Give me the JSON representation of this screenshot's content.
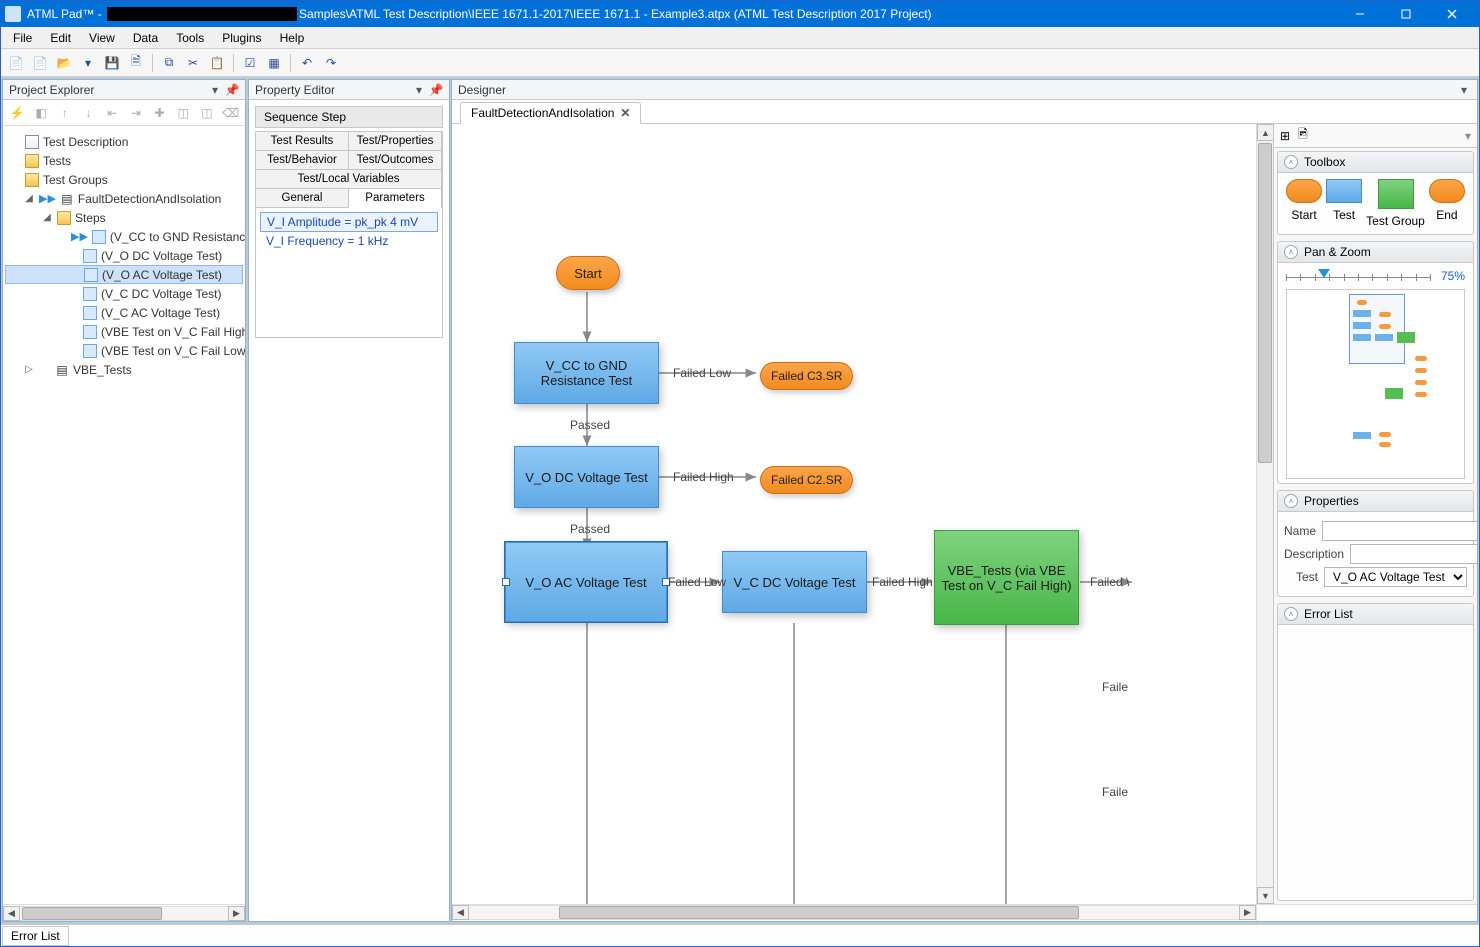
{
  "title_prefix": "ATML Pad™ - ",
  "title_suffix": "Samples\\ATML Test Description\\IEEE 1671.1-2017\\IEEE 1671.1 - Example3.atpx (ATML Test Description 2017 Project)",
  "menu": [
    "File",
    "Edit",
    "View",
    "Data",
    "Tools",
    "Plugins",
    "Help"
  ],
  "panels": {
    "project_explorer": "Project Explorer",
    "property_editor": "Property Editor",
    "designer": "Designer"
  },
  "tree": {
    "root": "Test Description",
    "tests": "Tests",
    "groups": "Test Groups",
    "fdi": "FaultDetectionAndIsolation",
    "steps_label": "Steps",
    "steps": [
      "(V_CC to GND Resistance Test)",
      "(V_O DC Voltage Test)",
      "(V_O AC Voltage Test)",
      "(V_C DC Voltage Test)",
      "(V_C AC Voltage Test)",
      "(VBE Test on V_C Fail High)",
      "(VBE Test on V_C Fail Low)"
    ],
    "vbe": "VBE_Tests"
  },
  "selected_tree_index": 2,
  "prop": {
    "group_title": "Sequence Step",
    "tabs": {
      "results": "Test Results",
      "properties": "Test/Properties",
      "behavior": "Test/Behavior",
      "outcomes": "Test/Outcomes",
      "localvars": "Test/Local Variables",
      "general": "General",
      "parameters": "Parameters"
    },
    "params": [
      "V_I Amplitude = pk_pk 4 mV",
      "V_I Frequency = 1 kHz"
    ]
  },
  "designer": {
    "tab_label": "FaultDetectionAndIsolation",
    "nodes": {
      "start": "Start",
      "n1": "V_CC to GND\nResistance Test",
      "n2": "V_O DC Voltage Test",
      "n3": "V_O AC Voltage Test",
      "n4": "V_C DC Voltage Test",
      "n5": "VBE_Tests (via VBE Test on V_C Fail High)",
      "b1": "Failed C3.SR",
      "b2": "Failed C2.SR"
    },
    "labels": {
      "passed": "Passed",
      "failed_low": "Failed Low",
      "failed_high": "Failed High",
      "failed_v": "Failed \\",
      "fail1": "Faile",
      "fail2": "Faile"
    }
  },
  "sidebar": {
    "toolbox_title": "Toolbox",
    "items": [
      "Start",
      "Test",
      "Test Group",
      "End"
    ],
    "panzoom_title": "Pan & Zoom",
    "zoom": "75%",
    "properties_title": "Properties",
    "name_label": "Name",
    "desc_label": "Description",
    "test_label": "Test",
    "test_value": "V_O AC Voltage Test",
    "errorlist_title": "Error List"
  },
  "status": {
    "errorlist": "Error List"
  }
}
